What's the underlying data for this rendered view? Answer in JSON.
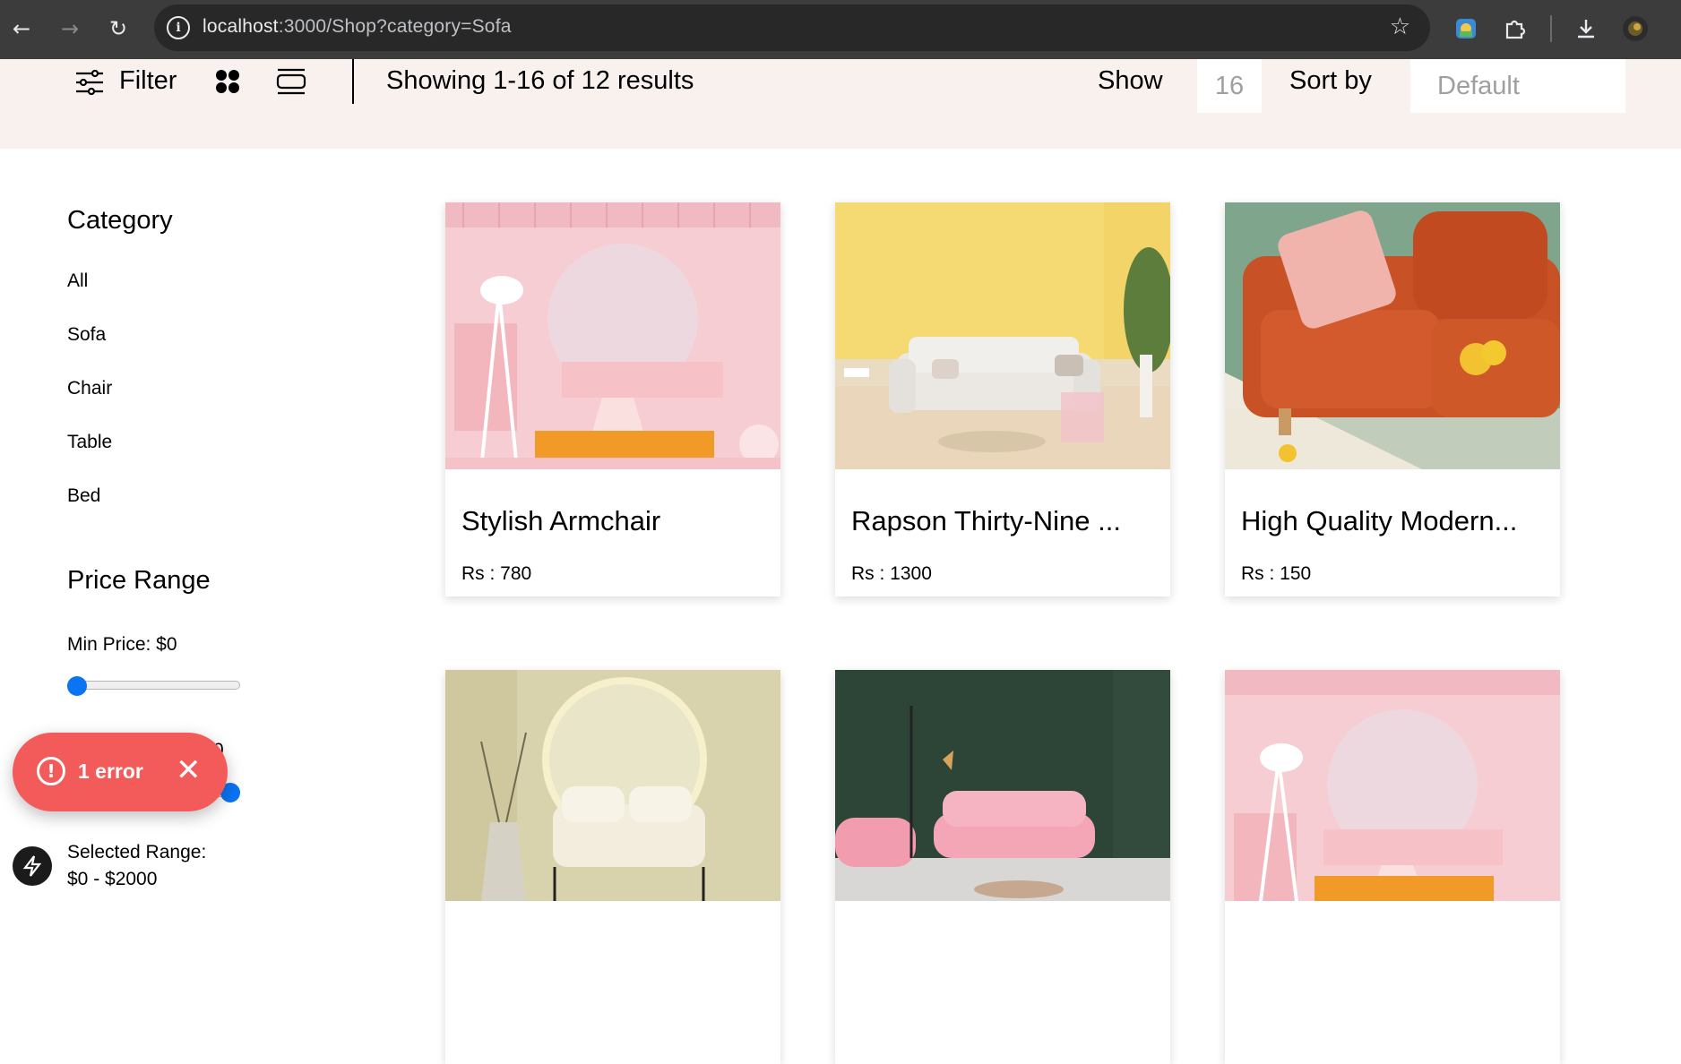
{
  "browser": {
    "url_host": "localhost",
    "url_rest": ":3000/Shop?category=Sofa",
    "icons": [
      "back-icon",
      "forward-icon",
      "reload-icon",
      "site-info-icon",
      "bookmark-star-icon",
      "extension-icon",
      "puzzle-icon",
      "download-icon",
      "profile-avatar"
    ]
  },
  "toolbar": {
    "filter_label": "Filter",
    "results_text": "Showing 1-16 of 12 results",
    "show_label": "Show",
    "show_value": "16",
    "sort_label": "Sort by",
    "sort_value": "Default",
    "background": "#f9f1ee"
  },
  "sidebar": {
    "category_title": "Category",
    "categories": [
      {
        "label": "All"
      },
      {
        "label": "Sofa"
      },
      {
        "label": "Chair"
      },
      {
        "label": "Table"
      },
      {
        "label": "Bed"
      }
    ],
    "price_title": "Price Range",
    "min_price_label": "Min Price: $0",
    "max_price_label_fragment": "0",
    "min_slider_fraction": 0,
    "max_slider_fraction": 1,
    "selected_range_label": "Selected Range:",
    "selected_range_value": "$0 - $2000",
    "slider_color": "#0b74f3"
  },
  "products": [
    {
      "name": "Stylish Armchair",
      "price": "Rs : 780",
      "image": "pink-room-armchair"
    },
    {
      "name": "Rapson Thirty-Nine ...",
      "price": "Rs : 1300",
      "image": "white-sofa-yellow-wall"
    },
    {
      "name": "High Quality Modern...",
      "price": "Rs : 150",
      "image": "orange-sofa-pillow"
    },
    {
      "name": "",
      "price": "",
      "image": "cream-loveseat-round-mirror"
    },
    {
      "name": "",
      "price": "",
      "image": "pink-sofa-green-wall"
    },
    {
      "name": "",
      "price": "",
      "image": "pink-room-armchair"
    }
  ],
  "error_toast": {
    "text": "1 error",
    "color": "#f35a5a"
  }
}
